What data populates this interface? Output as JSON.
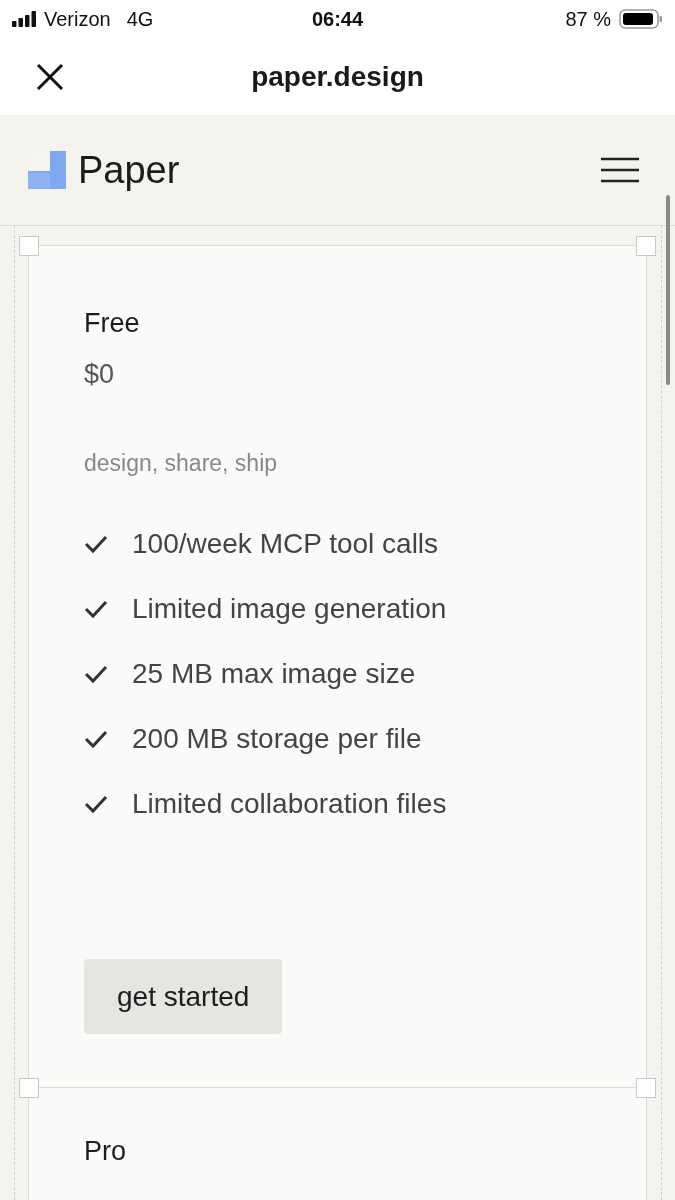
{
  "status_bar": {
    "carrier": "Verizon",
    "network": "4G",
    "time": "06:44",
    "battery": "87 %"
  },
  "browser": {
    "title": "paper.design"
  },
  "site_header": {
    "brand": "Paper"
  },
  "plans": [
    {
      "name": "Free",
      "price": "$0",
      "tagline": "design, share, ship",
      "features": [
        "100/week MCP tool calls",
        "Limited image generation",
        "25 MB max image size",
        "200 MB storage per file",
        "Limited collaboration files"
      ],
      "button": "get started"
    },
    {
      "name": "Pro"
    }
  ]
}
